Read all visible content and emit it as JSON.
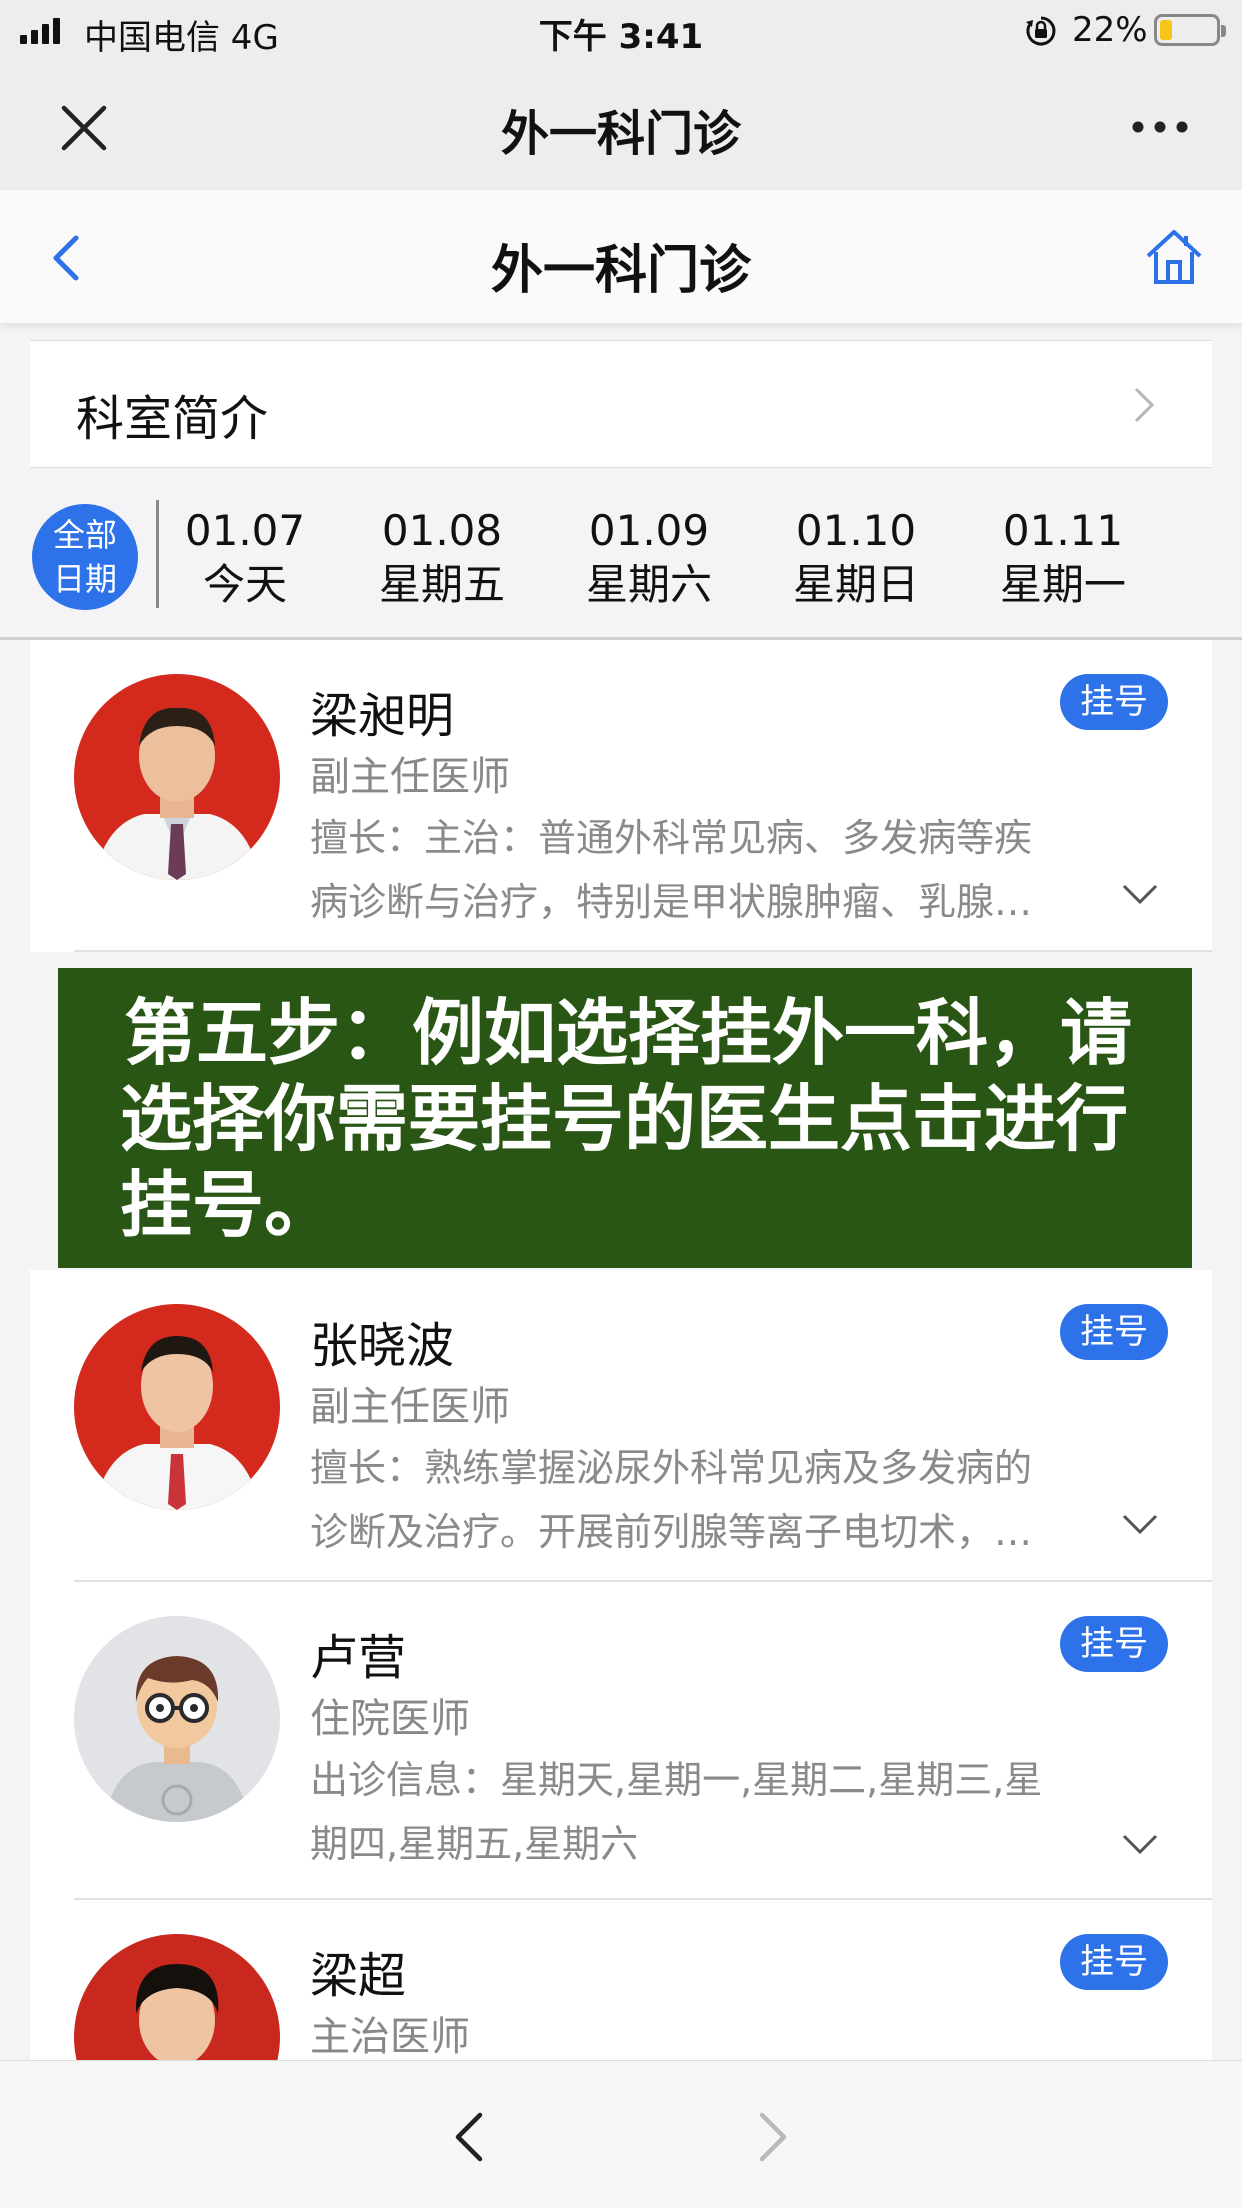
{
  "status_bar": {
    "carrier": "中国电信  4G",
    "time": "下午 3:41",
    "battery_text": "22%",
    "battery_level": 0.22
  },
  "wechat_bar": {
    "title": "外一科门诊",
    "close_icon": "close-icon",
    "more_icon": "more-icon"
  },
  "page_header": {
    "title": "外一科门诊",
    "back_icon": "chevron-left-icon",
    "home_icon": "home-icon"
  },
  "intro": {
    "label": "科室简介"
  },
  "dates": {
    "all_line1": "全部",
    "all_line2": "日期",
    "days": [
      {
        "date": "01.07",
        "weekday": "今天"
      },
      {
        "date": "01.08",
        "weekday": "星期五"
      },
      {
        "date": "01.09",
        "weekday": "星期六"
      },
      {
        "date": "01.10",
        "weekday": "星期日"
      },
      {
        "date": "01.11",
        "weekday": "星期一"
      }
    ]
  },
  "doctors": [
    {
      "name": "梁昶明",
      "title": "副主任医师",
      "desc_line1": "擅长：主治：普通外科常见病、多发病等疾",
      "desc_line2": "病诊断与治疗，特别是甲状腺肿瘤、乳腺…",
      "button": "挂号"
    },
    {
      "name": "张晓波",
      "title": "副主任医师",
      "desc_line1": "擅长：熟练掌握泌尿外科常见病及多发病的",
      "desc_line2": "诊断及治疗。开展前列腺等离子电切术，…",
      "button": "挂号"
    },
    {
      "name": "卢营",
      "title": "住院医师",
      "desc_line1": "出诊信息：星期天,星期一,星期二,星期三,星",
      "desc_line2": "期四,星期五,星期六",
      "button": "挂号"
    },
    {
      "name": "梁超",
      "title": "主治医师",
      "button": "挂号"
    }
  ],
  "banner": {
    "line1": "第五步：例如选择挂外一科，请",
    "line2": "选择你需要挂号的医生点击进行",
    "line3": "挂号。"
  },
  "colors": {
    "accent": "#2d72e8",
    "banner_bg": "#2a5615",
    "avatar_red": "#d42a1e"
  }
}
